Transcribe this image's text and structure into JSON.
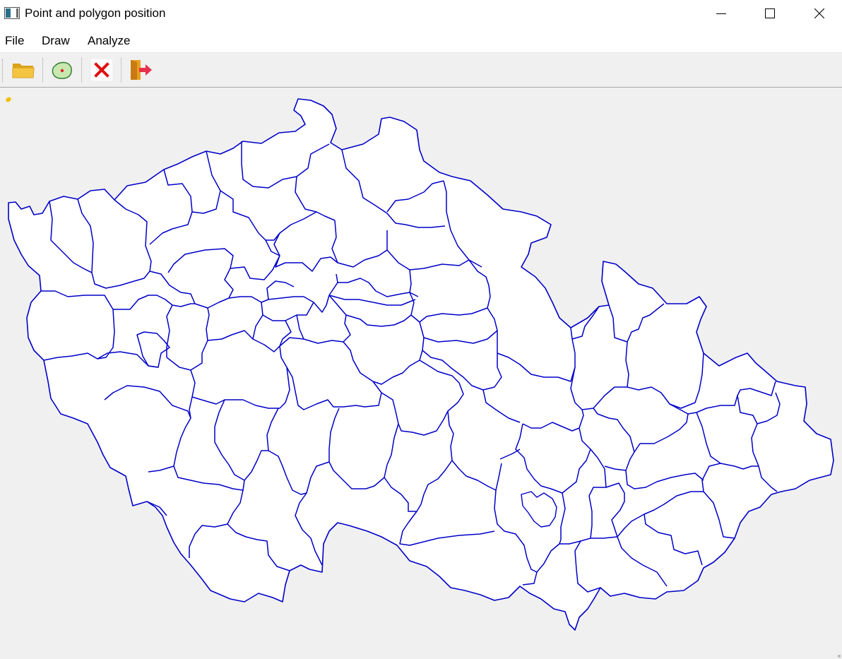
{
  "window": {
    "title": "Point and polygon position",
    "icon": "app-window-icon",
    "controls": [
      "minimize-icon",
      "maximize-icon",
      "close-icon"
    ]
  },
  "menu": {
    "file": "File",
    "draw": "Draw",
    "analyze": "Analyze"
  },
  "toolbar": {
    "tools": [
      {
        "icon": "folder-open-icon",
        "action": "open"
      },
      {
        "icon": "draw-point-polygon-icon",
        "action": "draw"
      },
      {
        "icon": "clear-x-icon",
        "action": "clear"
      },
      {
        "icon": "exit-door-icon",
        "action": "exit"
      }
    ]
  },
  "colors": {
    "polygon_stroke": "#0000c8",
    "polygon_fill": "#ffffff",
    "canvas_background": "#f0f0f0",
    "point_fill": "#f2c000"
  }
}
